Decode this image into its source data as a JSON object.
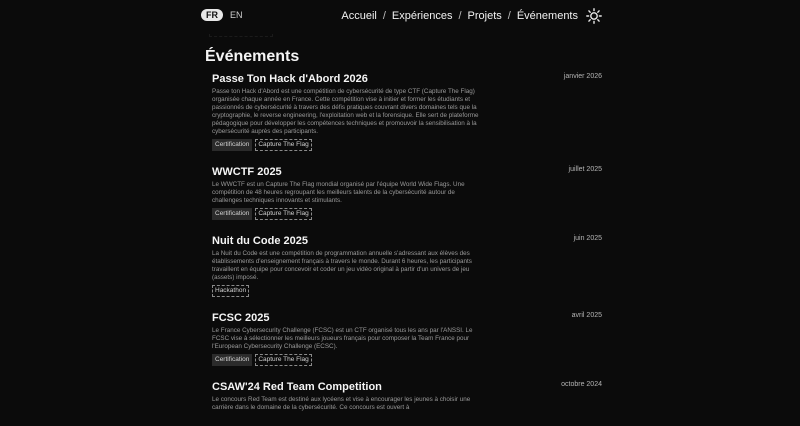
{
  "header": {
    "lang": {
      "fr": "FR",
      "en": "EN"
    },
    "nav": [
      "Accueil",
      "Expériences",
      "Projets",
      "Événements"
    ],
    "separator": "/"
  },
  "section": {
    "title": "Événements"
  },
  "events": [
    {
      "title": "Passe Ton Hack d'Abord 2026",
      "date": "janvier 2026",
      "description": "Passe ton Hack d'Abord est une compétition de cybersécurité de type CTF (Capture The Flag) organisée chaque année en France. Cette compétition vise à initier et former les étudiants et passionnés de cybersécurité à travers des défis pratiques couvrant divers domaines tels que la cryptographie, le reverse engineering, l'exploitation web et la forensique. Elle sert de plateforme pédagogique pour développer les compétences techniques et promouvoir la sensibilisation à la cybersécurité auprès des participants.",
      "tags": [
        {
          "label": "Certification",
          "style": "solid"
        },
        {
          "label": "Capture The Flag",
          "style": "dashed"
        }
      ]
    },
    {
      "title": "WWCTF 2025",
      "date": "juillet 2025",
      "description": "Le WWCTF est un Capture The Flag mondial organisé par l'équipe World Wide Flags. Une compétition de 48 heures regroupant les meilleurs talents de la cybersécurité autour de challenges techniques innovants et stimulants.",
      "tags": [
        {
          "label": "Certification",
          "style": "solid"
        },
        {
          "label": "Capture The Flag",
          "style": "dashed"
        }
      ]
    },
    {
      "title": "Nuit du Code 2025",
      "date": "juin 2025",
      "description": "La Nuit du Code est une compétition de programmation annuelle s'adressant aux élèves des établissements d'enseignement français à travers le monde. Durant 6 heures, les participants travaillent en équipe pour concevoir et coder un jeu vidéo original à partir d'un univers de jeu (assets) imposé.",
      "tags": [
        {
          "label": "Hackathon",
          "style": "dashed"
        }
      ]
    },
    {
      "title": "FCSC 2025",
      "date": "avril 2025",
      "description": "Le France Cybersecurity Challenge (FCSC) est un CTF organisé tous les ans par l'ANSSI. Le FCSC vise à sélectionner les meilleurs joueurs français pour composer la Team France pour l'European Cybersecurity Challenge (ECSC).",
      "tags": [
        {
          "label": "Certification",
          "style": "solid"
        },
        {
          "label": "Capture The Flag",
          "style": "dashed"
        }
      ]
    },
    {
      "title": "CSAW'24 Red Team Competition",
      "date": "octobre 2024",
      "description": "Le concours Red Team est destiné aux lycéens et vise à encourager les jeunes à choisir une carrière dans le domaine de la cybersécurité. Ce concours est ouvert à",
      "tags": []
    }
  ],
  "colors": {
    "background": "#0b0b0b",
    "text": "#e8e8e8",
    "muted": "#9a9a9a",
    "tag_bg": "#2b2b2b"
  },
  "icons": {
    "theme_toggle": "sun-icon"
  }
}
